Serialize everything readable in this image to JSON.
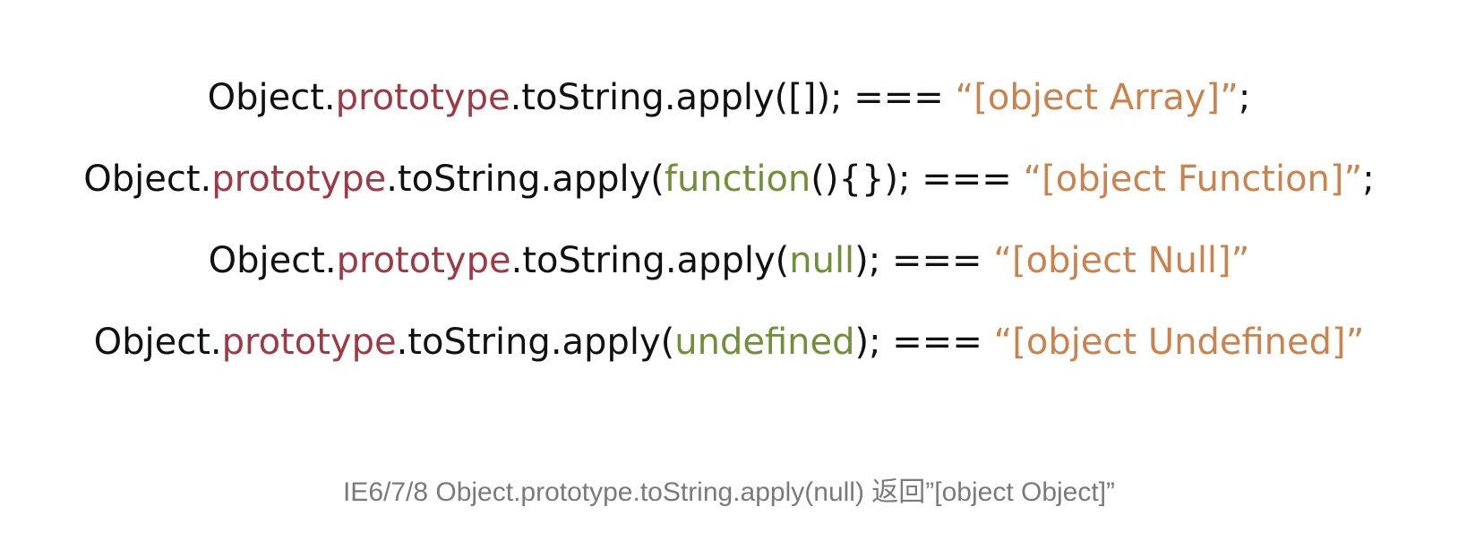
{
  "colors": {
    "background": "#ffffff",
    "plain": "#111111",
    "prototype": "#9b3b45",
    "argument": "#6f8f3a",
    "string": "#c8834f",
    "caption": "#7a7a7a"
  },
  "lines": [
    {
      "object": "Object",
      "dot1": ".",
      "prototype": "prototype",
      "call": ".toString.apply(",
      "argument": "[]",
      "close": "); === ",
      "result": "“[object Array]”",
      "end": ";"
    },
    {
      "object": "Object",
      "dot1": ".",
      "prototype": "prototype",
      "call": ".toString.apply(",
      "argument": "function",
      "argument_tail": "(){}",
      "close": "); === ",
      "result": "“[object Function]”",
      "end": ";"
    },
    {
      "object": "Object",
      "dot1": ".",
      "prototype": "prototype",
      "call": ".toString.apply(",
      "argument": "null",
      "close": "); === ",
      "result": "“[object Null]”",
      "end": ""
    },
    {
      "object": "Object",
      "dot1": ".",
      "prototype": "prototype",
      "call": ".toString.apply(",
      "argument": "undefined",
      "close": "); === ",
      "result": "“[object Undefined]”",
      "end": ""
    }
  ],
  "caption": "IE6/7/8 Object.prototype.toString.apply(null) 返回”[object Object]”"
}
